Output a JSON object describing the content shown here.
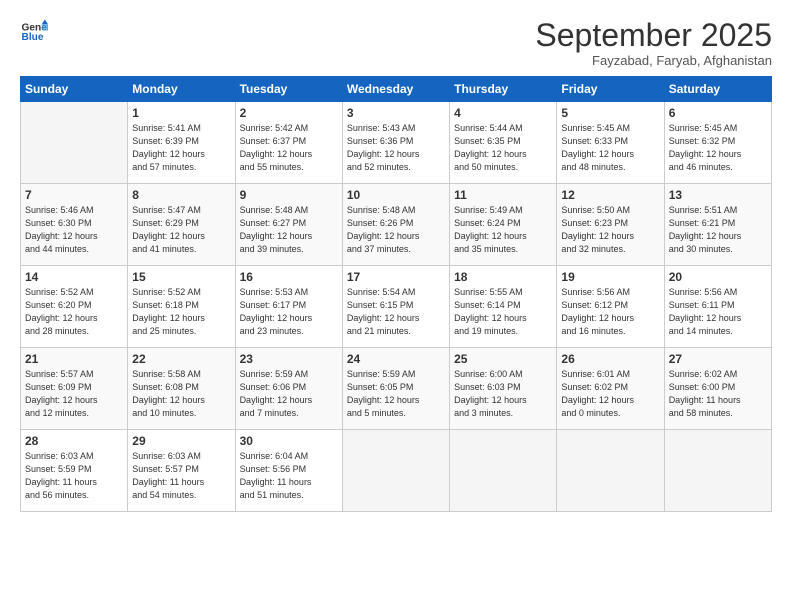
{
  "header": {
    "logo_line1": "General",
    "logo_line2": "Blue",
    "month": "September 2025",
    "location": "Fayzabad, Faryab, Afghanistan"
  },
  "weekdays": [
    "Sunday",
    "Monday",
    "Tuesday",
    "Wednesday",
    "Thursday",
    "Friday",
    "Saturday"
  ],
  "weeks": [
    [
      {
        "day": "",
        "info": ""
      },
      {
        "day": "1",
        "info": "Sunrise: 5:41 AM\nSunset: 6:39 PM\nDaylight: 12 hours\nand 57 minutes."
      },
      {
        "day": "2",
        "info": "Sunrise: 5:42 AM\nSunset: 6:37 PM\nDaylight: 12 hours\nand 55 minutes."
      },
      {
        "day": "3",
        "info": "Sunrise: 5:43 AM\nSunset: 6:36 PM\nDaylight: 12 hours\nand 52 minutes."
      },
      {
        "day": "4",
        "info": "Sunrise: 5:44 AM\nSunset: 6:35 PM\nDaylight: 12 hours\nand 50 minutes."
      },
      {
        "day": "5",
        "info": "Sunrise: 5:45 AM\nSunset: 6:33 PM\nDaylight: 12 hours\nand 48 minutes."
      },
      {
        "day": "6",
        "info": "Sunrise: 5:45 AM\nSunset: 6:32 PM\nDaylight: 12 hours\nand 46 minutes."
      }
    ],
    [
      {
        "day": "7",
        "info": "Sunrise: 5:46 AM\nSunset: 6:30 PM\nDaylight: 12 hours\nand 44 minutes."
      },
      {
        "day": "8",
        "info": "Sunrise: 5:47 AM\nSunset: 6:29 PM\nDaylight: 12 hours\nand 41 minutes."
      },
      {
        "day": "9",
        "info": "Sunrise: 5:48 AM\nSunset: 6:27 PM\nDaylight: 12 hours\nand 39 minutes."
      },
      {
        "day": "10",
        "info": "Sunrise: 5:48 AM\nSunset: 6:26 PM\nDaylight: 12 hours\nand 37 minutes."
      },
      {
        "day": "11",
        "info": "Sunrise: 5:49 AM\nSunset: 6:24 PM\nDaylight: 12 hours\nand 35 minutes."
      },
      {
        "day": "12",
        "info": "Sunrise: 5:50 AM\nSunset: 6:23 PM\nDaylight: 12 hours\nand 32 minutes."
      },
      {
        "day": "13",
        "info": "Sunrise: 5:51 AM\nSunset: 6:21 PM\nDaylight: 12 hours\nand 30 minutes."
      }
    ],
    [
      {
        "day": "14",
        "info": "Sunrise: 5:52 AM\nSunset: 6:20 PM\nDaylight: 12 hours\nand 28 minutes."
      },
      {
        "day": "15",
        "info": "Sunrise: 5:52 AM\nSunset: 6:18 PM\nDaylight: 12 hours\nand 25 minutes."
      },
      {
        "day": "16",
        "info": "Sunrise: 5:53 AM\nSunset: 6:17 PM\nDaylight: 12 hours\nand 23 minutes."
      },
      {
        "day": "17",
        "info": "Sunrise: 5:54 AM\nSunset: 6:15 PM\nDaylight: 12 hours\nand 21 minutes."
      },
      {
        "day": "18",
        "info": "Sunrise: 5:55 AM\nSunset: 6:14 PM\nDaylight: 12 hours\nand 19 minutes."
      },
      {
        "day": "19",
        "info": "Sunrise: 5:56 AM\nSunset: 6:12 PM\nDaylight: 12 hours\nand 16 minutes."
      },
      {
        "day": "20",
        "info": "Sunrise: 5:56 AM\nSunset: 6:11 PM\nDaylight: 12 hours\nand 14 minutes."
      }
    ],
    [
      {
        "day": "21",
        "info": "Sunrise: 5:57 AM\nSunset: 6:09 PM\nDaylight: 12 hours\nand 12 minutes."
      },
      {
        "day": "22",
        "info": "Sunrise: 5:58 AM\nSunset: 6:08 PM\nDaylight: 12 hours\nand 10 minutes."
      },
      {
        "day": "23",
        "info": "Sunrise: 5:59 AM\nSunset: 6:06 PM\nDaylight: 12 hours\nand 7 minutes."
      },
      {
        "day": "24",
        "info": "Sunrise: 5:59 AM\nSunset: 6:05 PM\nDaylight: 12 hours\nand 5 minutes."
      },
      {
        "day": "25",
        "info": "Sunrise: 6:00 AM\nSunset: 6:03 PM\nDaylight: 12 hours\nand 3 minutes."
      },
      {
        "day": "26",
        "info": "Sunrise: 6:01 AM\nSunset: 6:02 PM\nDaylight: 12 hours\nand 0 minutes."
      },
      {
        "day": "27",
        "info": "Sunrise: 6:02 AM\nSunset: 6:00 PM\nDaylight: 11 hours\nand 58 minutes."
      }
    ],
    [
      {
        "day": "28",
        "info": "Sunrise: 6:03 AM\nSunset: 5:59 PM\nDaylight: 11 hours\nand 56 minutes."
      },
      {
        "day": "29",
        "info": "Sunrise: 6:03 AM\nSunset: 5:57 PM\nDaylight: 11 hours\nand 54 minutes."
      },
      {
        "day": "30",
        "info": "Sunrise: 6:04 AM\nSunset: 5:56 PM\nDaylight: 11 hours\nand 51 minutes."
      },
      {
        "day": "",
        "info": ""
      },
      {
        "day": "",
        "info": ""
      },
      {
        "day": "",
        "info": ""
      },
      {
        "day": "",
        "info": ""
      }
    ]
  ]
}
